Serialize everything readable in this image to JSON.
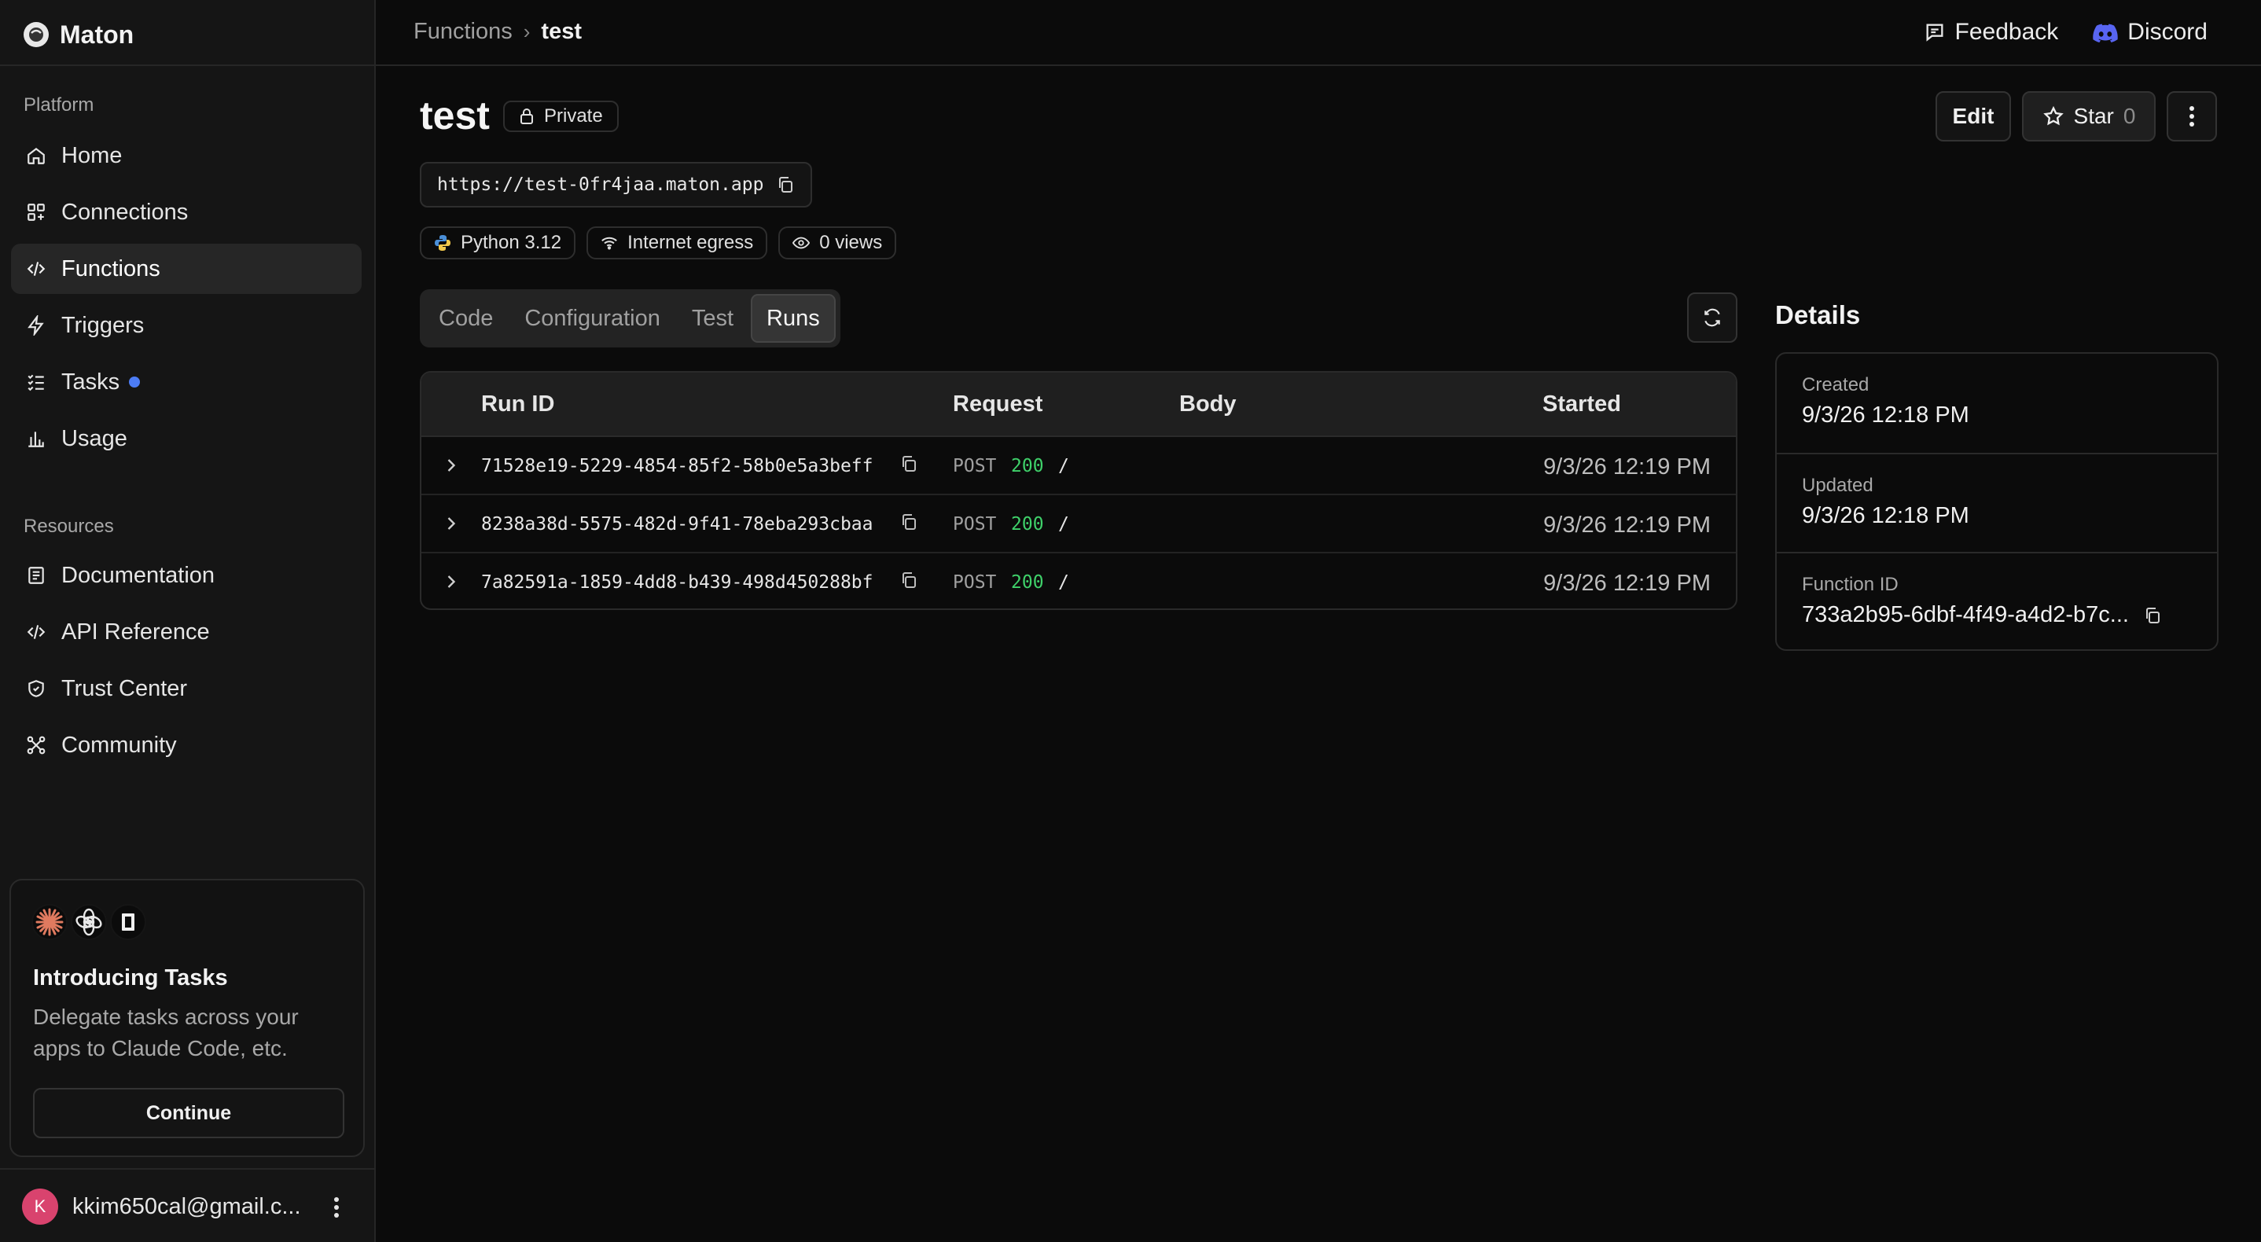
{
  "app": {
    "name": "Maton"
  },
  "sidebar": {
    "platform_label": "Platform",
    "platform_items": [
      {
        "label": "Home",
        "icon": "home-icon"
      },
      {
        "label": "Connections",
        "icon": "grid-icon"
      },
      {
        "label": "Functions",
        "icon": "code-icon",
        "active": true
      },
      {
        "label": "Triggers",
        "icon": "bolt-icon"
      },
      {
        "label": "Tasks",
        "icon": "checklist-icon",
        "badge": "new-dot"
      },
      {
        "label": "Usage",
        "icon": "chart-icon"
      }
    ],
    "resources_label": "Resources",
    "resource_items": [
      {
        "label": "Documentation",
        "icon": "book-icon"
      },
      {
        "label": "API Reference",
        "icon": "code-icon"
      },
      {
        "label": "Trust Center",
        "icon": "shield-icon"
      },
      {
        "label": "Community",
        "icon": "community-icon"
      }
    ],
    "promo": {
      "title": "Introducing Tasks",
      "description": "Delegate tasks across your apps to Claude Code, etc.",
      "button": "Continue"
    },
    "user": {
      "initial": "K",
      "email": "kkim650cal@gmail.c..."
    }
  },
  "topbar": {
    "breadcrumb_parent": "Functions",
    "breadcrumb_separator": "›",
    "breadcrumb_current": "test",
    "feedback": "Feedback",
    "discord": "Discord"
  },
  "function": {
    "name": "test",
    "visibility": "Private",
    "url": "https://test-0fr4jaa.maton.app",
    "runtime": "Python 3.12",
    "network": "Internet egress",
    "views": "0 views"
  },
  "actions": {
    "edit": "Edit",
    "star": "Star",
    "star_count": "0"
  },
  "tabs": [
    {
      "label": "Code"
    },
    {
      "label": "Configuration"
    },
    {
      "label": "Test"
    },
    {
      "label": "Runs",
      "active": true
    }
  ],
  "runs": {
    "columns": {
      "run_id": "Run ID",
      "request": "Request",
      "body": "Body",
      "started": "Started"
    },
    "rows": [
      {
        "id": "71528e19-5229-4854-85f2-58b0e5a3beff",
        "method": "POST",
        "status": "200",
        "path": "/",
        "started": "9/3/26 12:19 PM"
      },
      {
        "id": "8238a38d-5575-482d-9f41-78eba293cbaa",
        "method": "POST",
        "status": "200",
        "path": "/",
        "started": "9/3/26 12:19 PM"
      },
      {
        "id": "7a82591a-1859-4dd8-b439-498d450288bf",
        "method": "POST",
        "status": "200",
        "path": "/",
        "started": "9/3/26 12:19 PM"
      }
    ]
  },
  "details": {
    "title": "Details",
    "created_label": "Created",
    "created": "9/3/26 12:18 PM",
    "updated_label": "Updated",
    "updated": "9/3/26 12:18 PM",
    "function_id_label": "Function ID",
    "function_id": "733a2b95-6dbf-4f49-a4d2-b7c..."
  },
  "colors": {
    "accent_blue": "#4c7cf5",
    "status_ok": "#3fd16a",
    "discord": "#5865f2",
    "avatar": "#d9436e"
  }
}
